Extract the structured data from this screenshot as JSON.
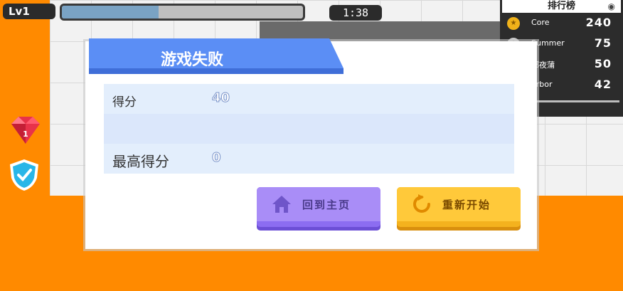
{
  "hud": {
    "level_label": "Lv1",
    "xp_progress": 0.4,
    "timer": "1:38"
  },
  "leaderboard": {
    "title": "排行榜",
    "entries": [
      {
        "name": "Core",
        "score": "240",
        "medal_color": "#f0b21a"
      },
      {
        "name": "Summer",
        "score": "75",
        "medal_color": "#c9c9c9"
      },
      {
        "name": "邪夜蒲",
        "score": "50",
        "medal_color": "#2c2c2c"
      },
      {
        "name": "arbor",
        "score": "42",
        "medal_color": "#2c2c2c"
      }
    ]
  },
  "side_icons": {
    "lives": "1"
  },
  "modal": {
    "title": "游戏失败",
    "rows": [
      {
        "label": "得分",
        "value": "40"
      },
      {
        "label": "",
        "value": ""
      },
      {
        "label": "最高得分",
        "value": "0"
      }
    ],
    "home_button": "回到主页",
    "retry_button": "重新开始"
  },
  "colors": {
    "background_orange": "#ff8a00",
    "title_blue": "#5b8ef5",
    "home_purple": "#a98df7",
    "retry_yellow": "#ffc93a"
  }
}
